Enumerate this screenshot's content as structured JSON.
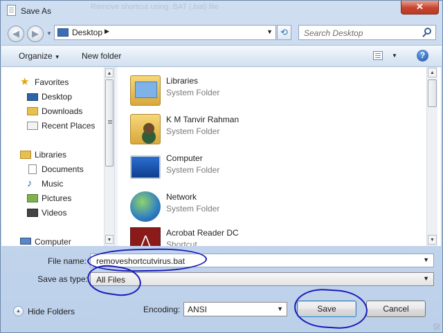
{
  "window": {
    "title": "Save As",
    "background_title": "Remove shortcut using .BAT (.bat) file",
    "close_glyph": "✕"
  },
  "address_bar": {
    "location": "Desktop",
    "separator": "▶",
    "search_placeholder": "Search Desktop"
  },
  "toolbar": {
    "organize_label": "Organize",
    "new_folder_label": "New folder"
  },
  "nav_pane": {
    "items": [
      {
        "label": "Favorites",
        "icon": "star-icon"
      },
      {
        "label": "Desktop",
        "icon": "desktop-icon"
      },
      {
        "label": "Downloads",
        "icon": "downloads-icon"
      },
      {
        "label": "Recent Places",
        "icon": "recent-places-icon"
      },
      {
        "label": "Libraries",
        "icon": "libraries-icon"
      },
      {
        "label": "Documents",
        "icon": "documents-icon"
      },
      {
        "label": "Music",
        "icon": "music-icon"
      },
      {
        "label": "Pictures",
        "icon": "pictures-icon"
      },
      {
        "label": "Videos",
        "icon": "videos-icon"
      },
      {
        "label": "Computer",
        "icon": "computer-icon"
      }
    ]
  },
  "files": [
    {
      "name": "Libraries",
      "type": "System Folder"
    },
    {
      "name": "K M Tanvir Rahman",
      "type": "System Folder"
    },
    {
      "name": "Computer",
      "type": "System Folder"
    },
    {
      "name": "Network",
      "type": "System Folder"
    },
    {
      "name": "Acrobat Reader DC",
      "type": "Shortcut"
    }
  ],
  "form": {
    "file_name_label": "File name:",
    "file_name_value": "removeshortcutvirus.bat",
    "save_type_label": "Save as type:",
    "save_type_value": "All Files",
    "encoding_label": "Encoding:",
    "encoding_value": "ANSI"
  },
  "footer": {
    "hide_folders_label": "Hide Folders",
    "save_label": "Save",
    "cancel_label": "Cancel"
  },
  "colors": {
    "annotation_ink": "#1a1ab8",
    "window_frame": "#cfdef0"
  }
}
